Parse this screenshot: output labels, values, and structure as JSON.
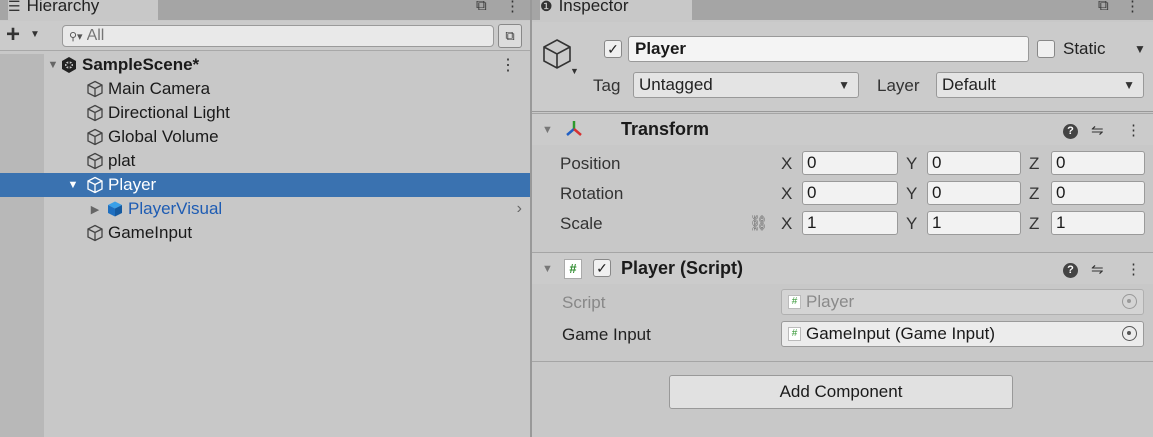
{
  "hierarchy": {
    "tab_label": "Hierarchy",
    "tab_icon": "list-icon",
    "search_placeholder": "All",
    "add_label": "+",
    "items": [
      {
        "label": "SampleScene*",
        "type": "scene",
        "expanded": true
      },
      {
        "label": "Main Camera",
        "type": "gameobject"
      },
      {
        "label": "Directional Light",
        "type": "gameobject"
      },
      {
        "label": "Global Volume",
        "type": "gameobject"
      },
      {
        "label": "plat",
        "type": "gameobject"
      },
      {
        "label": "Player",
        "type": "gameobject",
        "selected": true,
        "expanded": true
      },
      {
        "label": "PlayerVisual",
        "type": "prefab",
        "expanded": false
      },
      {
        "label": "GameInput",
        "type": "gameobject"
      }
    ]
  },
  "inspector": {
    "tab_label": "Inspector",
    "tab_icon": "info-icon",
    "object_active": true,
    "object_name": "Player",
    "static_label": "Static",
    "static_checked": false,
    "tag_label": "Tag",
    "tag_value": "Untagged",
    "layer_label": "Layer",
    "layer_value": "Default",
    "transform": {
      "title": "Transform",
      "rows": [
        {
          "label": "Position",
          "x": "0",
          "y": "0",
          "z": "0"
        },
        {
          "label": "Rotation",
          "x": "0",
          "y": "0",
          "z": "0"
        },
        {
          "label": "Scale",
          "x": "1",
          "y": "1",
          "z": "1"
        }
      ],
      "axis_x": "X",
      "axis_y": "Y",
      "axis_z": "Z"
    },
    "player_script": {
      "title": "Player (Script)",
      "enabled": true,
      "script_label": "Script",
      "script_value": "Player",
      "game_input_label": "Game Input",
      "game_input_value": "GameInput (Game Input)"
    },
    "add_component_label": "Add Component"
  },
  "colors": {
    "selection": "#3a72b0",
    "prefab_text": "#1e5cb3",
    "panel_bg": "#c8c8c8"
  }
}
